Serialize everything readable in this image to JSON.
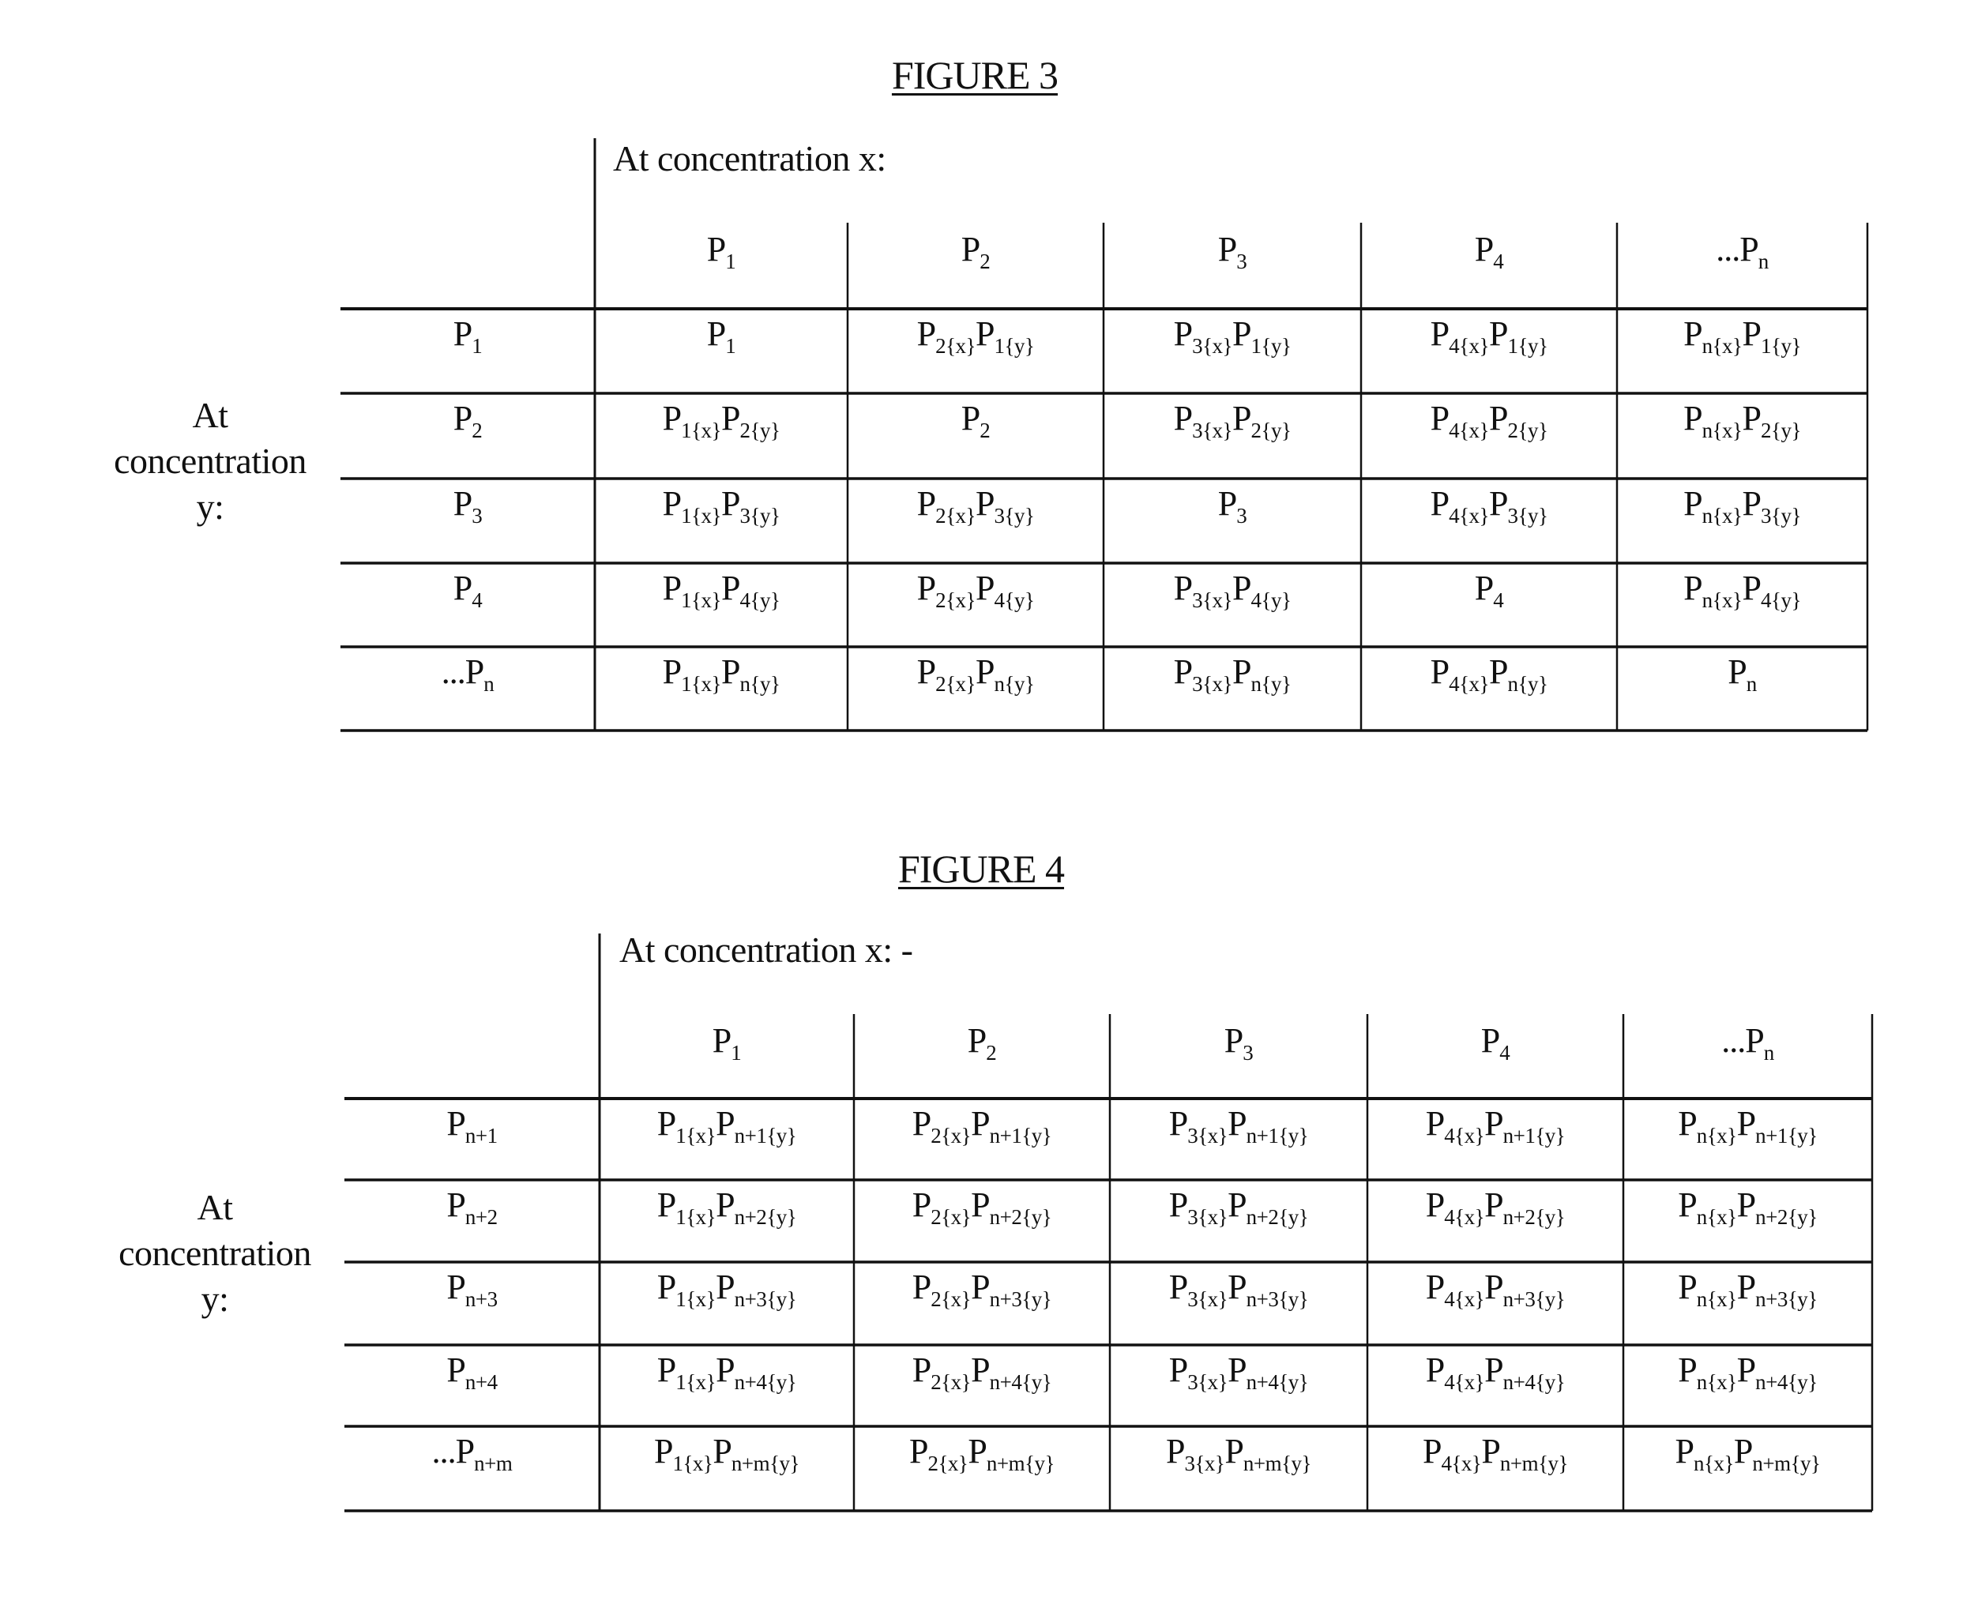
{
  "figures": [
    {
      "id": "figure-3",
      "title": "FIGURE 3",
      "x_axis_label": "At concentration x:",
      "y_axis_label_lines": [
        "At",
        "concentration",
        "y:"
      ],
      "column_headers": [
        [
          [
            "P",
            "1"
          ]
        ],
        [
          [
            "P",
            "2"
          ]
        ],
        [
          [
            "P",
            "3"
          ]
        ],
        [
          [
            "P",
            "4"
          ]
        ],
        [
          [
            "...P",
            "n"
          ]
        ]
      ],
      "row_headers": [
        [
          [
            "P",
            "1"
          ]
        ],
        [
          [
            "P",
            "2"
          ]
        ],
        [
          [
            "P",
            "3"
          ]
        ],
        [
          [
            "P",
            "4"
          ]
        ],
        [
          [
            "...P",
            "n"
          ]
        ]
      ],
      "cells": [
        [
          [
            [
              "P",
              "1"
            ]
          ],
          [
            [
              "P",
              "2{x}"
            ],
            [
              "P",
              "1{y}"
            ]
          ],
          [
            [
              "P",
              "3{x}"
            ],
            [
              "P",
              "1{y}"
            ]
          ],
          [
            [
              "P",
              "4{x}"
            ],
            [
              "P",
              "1{y}"
            ]
          ],
          [
            [
              "P",
              "n{x}"
            ],
            [
              "P",
              "1{y}"
            ]
          ]
        ],
        [
          [
            [
              "P",
              "1{x}"
            ],
            [
              "P",
              "2{y}"
            ]
          ],
          [
            [
              "P",
              "2"
            ]
          ],
          [
            [
              "P",
              "3{x}"
            ],
            [
              "P",
              "2{y}"
            ]
          ],
          [
            [
              "P",
              "4{x}"
            ],
            [
              "P",
              "2{y}"
            ]
          ],
          [
            [
              "P",
              "n{x}"
            ],
            [
              "P",
              "2{y}"
            ]
          ]
        ],
        [
          [
            [
              "P",
              "1{x}"
            ],
            [
              "P",
              "3{y}"
            ]
          ],
          [
            [
              "P",
              "2{x}"
            ],
            [
              "P",
              "3{y}"
            ]
          ],
          [
            [
              "P",
              "3"
            ]
          ],
          [
            [
              "P",
              "4{x}"
            ],
            [
              "P",
              "3{y}"
            ]
          ],
          [
            [
              "P",
              "n{x}"
            ],
            [
              "P",
              "3{y}"
            ]
          ]
        ],
        [
          [
            [
              "P",
              "1{x}"
            ],
            [
              "P",
              "4{y}"
            ]
          ],
          [
            [
              "P",
              "2{x}"
            ],
            [
              "P",
              "4{y}"
            ]
          ],
          [
            [
              "P",
              "3{x}"
            ],
            [
              "P",
              "4{y}"
            ]
          ],
          [
            [
              "P",
              "4"
            ]
          ],
          [
            [
              "P",
              "n{x}"
            ],
            [
              "P",
              "4{y}"
            ]
          ]
        ],
        [
          [
            [
              "P",
              "1{x}"
            ],
            [
              "P",
              "n{y}"
            ]
          ],
          [
            [
              "P",
              "2{x}"
            ],
            [
              "P",
              "n{y}"
            ]
          ],
          [
            [
              "P",
              "3{x}"
            ],
            [
              "P",
              "n{y}"
            ]
          ],
          [
            [
              "P",
              "4{x}"
            ],
            [
              "P",
              "n{y}"
            ]
          ],
          [
            [
              "P",
              "n"
            ]
          ]
        ]
      ]
    },
    {
      "id": "figure-4",
      "title": "FIGURE 4",
      "x_axis_label": "At concentration x: -",
      "y_axis_label_lines": [
        "At",
        "concentration",
        "y:"
      ],
      "column_headers": [
        [
          [
            "P",
            "1"
          ]
        ],
        [
          [
            "P",
            "2"
          ]
        ],
        [
          [
            "P",
            "3"
          ]
        ],
        [
          [
            "P",
            "4"
          ]
        ],
        [
          [
            "...P",
            "n"
          ]
        ]
      ],
      "row_headers": [
        [
          [
            "P",
            "n+1"
          ]
        ],
        [
          [
            "P",
            "n+2"
          ]
        ],
        [
          [
            "P",
            "n+3"
          ]
        ],
        [
          [
            "P",
            "n+4"
          ]
        ],
        [
          [
            "...P",
            "n+m"
          ]
        ]
      ],
      "cells": [
        [
          [
            [
              "P",
              "1{x}"
            ],
            [
              "P",
              "n+1{y}"
            ]
          ],
          [
            [
              "P",
              "2{x}"
            ],
            [
              "P",
              "n+1{y}"
            ]
          ],
          [
            [
              "P",
              "3{x}"
            ],
            [
              "P",
              "n+1{y}"
            ]
          ],
          [
            [
              "P",
              "4{x}"
            ],
            [
              "P",
              "n+1{y}"
            ]
          ],
          [
            [
              "P",
              "n{x}"
            ],
            [
              "P",
              "n+1{y}"
            ]
          ]
        ],
        [
          [
            [
              "P",
              "1{x}"
            ],
            [
              "P",
              "n+2{y}"
            ]
          ],
          [
            [
              "P",
              "2{x}"
            ],
            [
              "P",
              "n+2{y}"
            ]
          ],
          [
            [
              "P",
              "3{x}"
            ],
            [
              "P",
              "n+2{y}"
            ]
          ],
          [
            [
              "P",
              "4{x}"
            ],
            [
              "P",
              "n+2{y}"
            ]
          ],
          [
            [
              "P",
              "n{x}"
            ],
            [
              "P",
              "n+2{y}"
            ]
          ]
        ],
        [
          [
            [
              "P",
              "1{x}"
            ],
            [
              "P",
              "n+3{y}"
            ]
          ],
          [
            [
              "P",
              "2{x}"
            ],
            [
              "P",
              "n+3{y}"
            ]
          ],
          [
            [
              "P",
              "3{x}"
            ],
            [
              "P",
              "n+3{y}"
            ]
          ],
          [
            [
              "P",
              "4{x}"
            ],
            [
              "P",
              "n+3{y}"
            ]
          ],
          [
            [
              "P",
              "n{x}"
            ],
            [
              "P",
              "n+3{y}"
            ]
          ]
        ],
        [
          [
            [
              "P",
              "1{x}"
            ],
            [
              "P",
              "n+4{y}"
            ]
          ],
          [
            [
              "P",
              "2{x}"
            ],
            [
              "P",
              "n+4{y}"
            ]
          ],
          [
            [
              "P",
              "3{x}"
            ],
            [
              "P",
              "n+4{y}"
            ]
          ],
          [
            [
              "P",
              "4{x}"
            ],
            [
              "P",
              "n+4{y}"
            ]
          ],
          [
            [
              "P",
              "n{x}"
            ],
            [
              "P",
              "n+4{y}"
            ]
          ]
        ],
        [
          [
            [
              "P",
              "1{x}"
            ],
            [
              "P",
              "n+m{y}"
            ]
          ],
          [
            [
              "P",
              "2{x}"
            ],
            [
              "P",
              "n+m{y}"
            ]
          ],
          [
            [
              "P",
              "3{x}"
            ],
            [
              "P",
              "n+m{y}"
            ]
          ],
          [
            [
              "P",
              "4{x}"
            ],
            [
              "P",
              "n+m{y}"
            ]
          ],
          [
            [
              "P",
              "n{x}"
            ],
            [
              "P",
              "n+m{y}"
            ]
          ]
        ]
      ]
    }
  ]
}
